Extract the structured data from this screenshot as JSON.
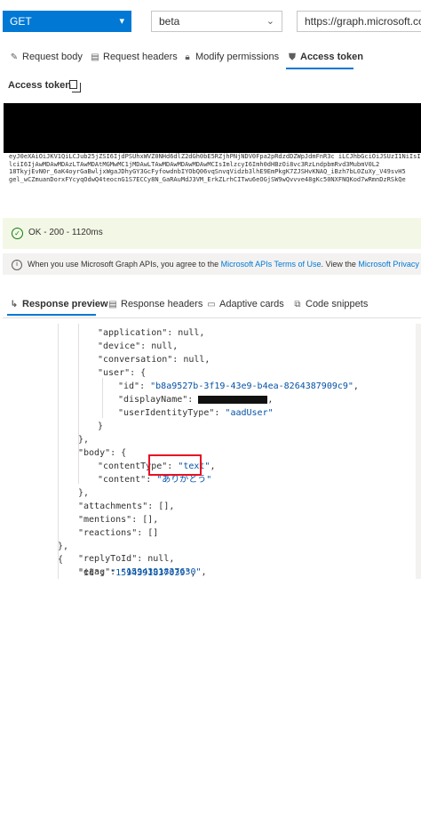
{
  "toolbar": {
    "method": "GET",
    "version": "beta",
    "url": "https://graph.microsoft.com/b"
  },
  "request_tabs": [
    {
      "label": "Request body",
      "icon": "pencil-icon"
    },
    {
      "label": "Request headers",
      "icon": "document-icon"
    },
    {
      "label": "Modify permissions",
      "icon": "lock-icon"
    },
    {
      "label": "Access token",
      "icon": "shield-icon",
      "active": true
    }
  ],
  "access_token": {
    "label": "Access token",
    "visible_text": "eyJ0eXAiOiJKV1QiLCJub25jZSI6IjdPSUhxWVZ0NHd6dlZ2dGh0bE5RZjhPNjNDV0Fpa2pRdzdDZWpJdmFnR3c iLCJhbGciOiJSUzI1NiIsIng1dCI6Imh1Tjk1SXZQZmVocTM0R3pCRFoxR1hHaXJuTSIsImtpZCI6Imh1Tjk1SXZQZmVocTM0R3pC\nlciI6IjAwMDAwMDAzLTAwMDAtMGMwMC1jMDAwLTAwMDAwMDAwMDAwMCIsImlzcyI6Imh0dHBzOi8vc3RzLndpbmRvd3MubmV0L2\n18TkyjEvN0r_6aK4oyrGaBwljxWgaJDhyGY3GcFyfowdnbIYObQ06vqSnvqVidzb3lhE9EmPkgK7ZJSHvKNAQ_iBzh7bL0ZuXy_V49svH5\ngel_wCZmuanDorxFYcyqOdwQ4teocnG1S7ECCy8N_GaRAuMdJ3VM_ErkZLrhCITwu6eOGjSW9wQvvve48gKc50NXFNQKod7wRmnDzRSkQe"
  },
  "status": {
    "text": "OK - 200 - 1120ms"
  },
  "info_banner": {
    "prefix": "When you use Microsoft Graph APIs, you agree to the",
    "terms_link": "Microsoft APIs Terms of Use",
    "middle": ". View the",
    "privacy_link": "Microsoft Privacy Stateme"
  },
  "response_tabs": [
    {
      "label": "Response preview",
      "icon": "preview-icon",
      "active": true
    },
    {
      "label": "Response headers",
      "icon": "document-icon"
    },
    {
      "label": "Adaptive cards",
      "icon": "card-icon"
    },
    {
      "label": "Code snippets",
      "icon": "code-icon"
    }
  ],
  "response_json": {
    "application_line": "\"application\": null,",
    "device_line": "\"device\": null,",
    "conversation_line": "\"conversation\": null,",
    "user_open": "\"user\": {",
    "id_key": "\"id\"",
    "id_value": "\"b8a9527b-3f19-43e9-b4ea-8264387909c9\"",
    "displayname_key": "\"displayName\"",
    "useridentitytype_key": "\"userIdentityType\"",
    "useridentitytype_value": "\"aadUser\"",
    "body_open": "\"body\": {",
    "contenttype_key": "\"contentType\"",
    "contenttype_value": "\"text\"",
    "content_key": "\"content\"",
    "content_value": "\"ありがとう\"",
    "attachments_line": "\"attachments\": [],",
    "mentions_line": "\"mentions\": [],",
    "reactions_line": "\"reactions\": []",
    "id2_key": "\"id\"",
    "id2_value": "\"1594391837039\"",
    "replytoid_line": "\"replyToId\": null,",
    "etag_key": "\"etag\"",
    "etag_value": "\"1594391837630\""
  }
}
